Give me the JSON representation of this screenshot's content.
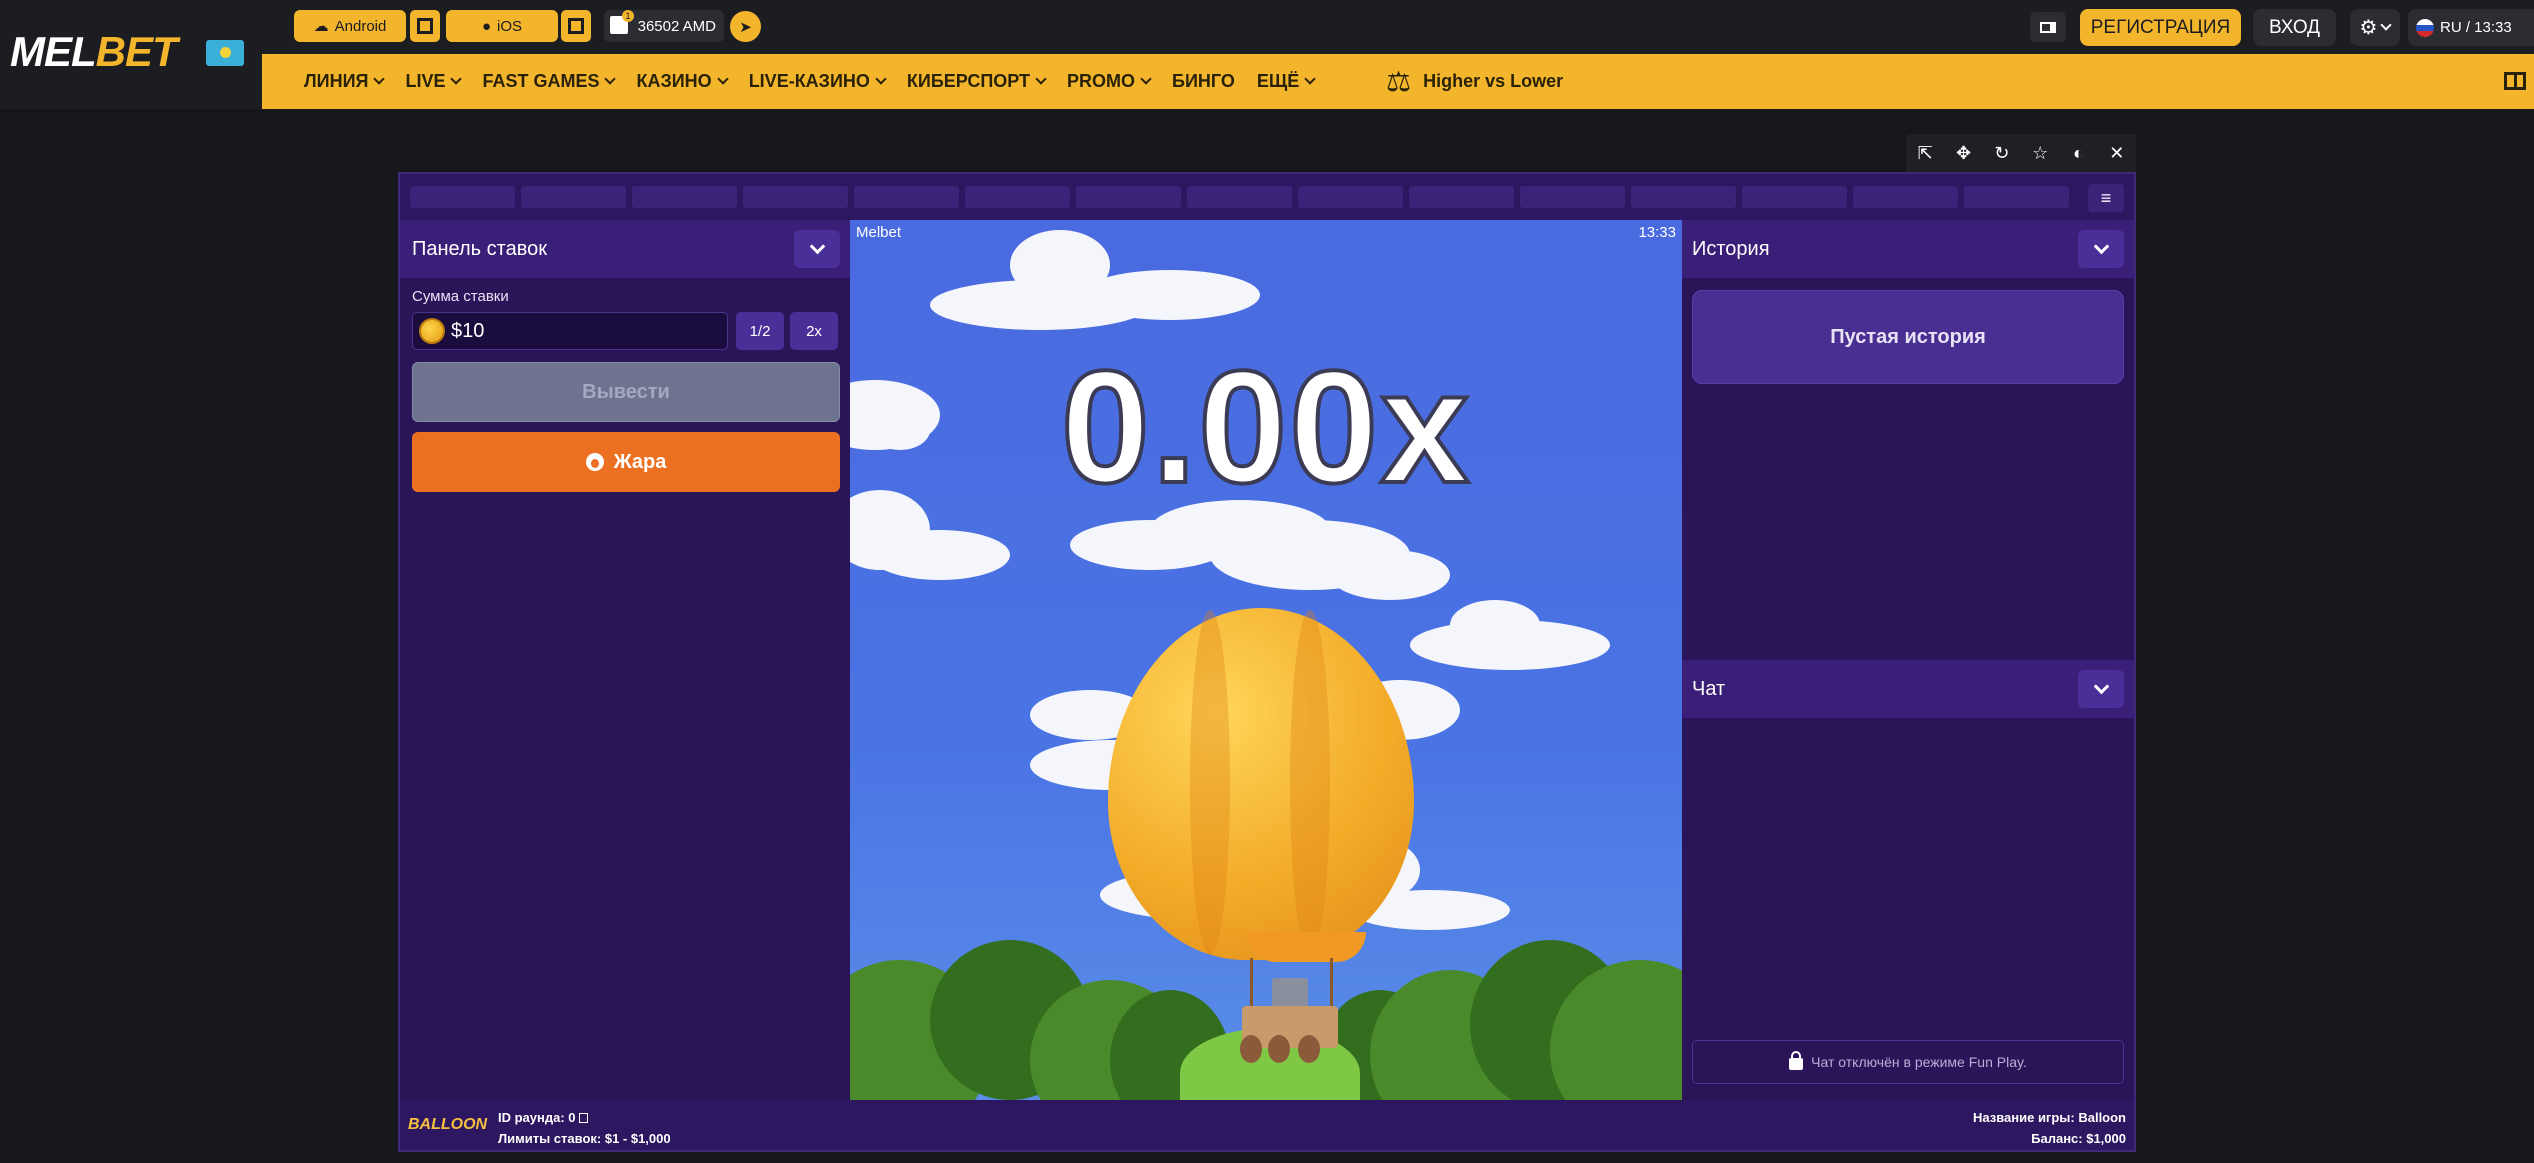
{
  "header": {
    "logo_mel": "MEL",
    "logo_bet": "BET",
    "android_label": "Android",
    "ios_label": "iOS",
    "gift_badge": "1",
    "balance": "36502 AMD",
    "register_label": "РЕГИСТРАЦИЯ",
    "login_label": "ВХОД",
    "lang_time": "RU / 13:33"
  },
  "nav": {
    "items": [
      "ЛИНИЯ",
      "LIVE",
      "FAST GAMES",
      "КАЗИНО",
      "LIVE-КАЗИНО",
      "КИБЕРСПОРТ",
      "PROMO",
      "БИНГО",
      "ЕЩЁ"
    ],
    "featured_game": "Higher vs Lower"
  },
  "bet_panel": {
    "title": "Панель ставок",
    "stake_label": "Сумма ставки",
    "stake_value": "$10",
    "half_label": "1/2",
    "double_label": "2x",
    "cashout_label": "Вывести",
    "fire_label": "Жара"
  },
  "scene": {
    "brand": "Melbet",
    "time": "13:33",
    "multiplier": "0.00x"
  },
  "history": {
    "title": "История",
    "empty_label": "Пустая история"
  },
  "chat": {
    "title": "Чат",
    "disabled_label": "Чат отключён в режиме Fun Play."
  },
  "footer": {
    "logo": "BALLOON",
    "round_id": "ID раунда: 0",
    "limits": "Лимиты ставок: $1 - $1,000",
    "game_name": "Название игры: Balloon",
    "balance": "Баланс: $1,000"
  },
  "colors": {
    "brand_yellow": "#f3b52c",
    "game_purple": "#2a1558",
    "fire_orange": "#ec7022"
  }
}
